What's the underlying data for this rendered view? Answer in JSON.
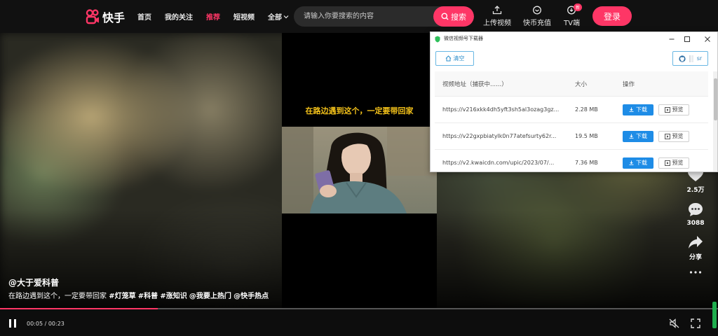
{
  "nav": {
    "logo_text": "快手",
    "items": [
      {
        "label": "首页",
        "active": false
      },
      {
        "label": "我的关注",
        "active": false
      },
      {
        "label": "推荐",
        "active": true
      },
      {
        "label": "短视频",
        "active": false
      }
    ],
    "all_label": "全部",
    "search": {
      "placeholder": "请输入你要搜索的内容",
      "button_label": "搜索"
    },
    "tools": [
      {
        "label": "上传视频",
        "icon": "upload-icon"
      },
      {
        "label": "快币充值",
        "icon": "coin-icon"
      },
      {
        "label": "TV端",
        "icon": "tv-icon",
        "badge": "新"
      }
    ],
    "login_label": "登录"
  },
  "video": {
    "caption": "在路边遇到这个，一定要带回家",
    "author": "@大于爱科普",
    "description": "在路边遇到这个，一定要带回家",
    "tags": [
      "#灯笼草",
      "#科普",
      "#涨知识",
      "@我要上热门",
      "@快手热点"
    ],
    "likes": "2.5万",
    "comments": "3088",
    "share_label": "分享",
    "current_time": "00:05",
    "duration": "00:23",
    "progress": 0.22
  },
  "downloader": {
    "title": "微信视频号下载器",
    "clear_label": "清空",
    "github_label": "sr",
    "columns": [
      "视频地址（捕获中......）",
      "大小",
      "操作"
    ],
    "download_label": "下载",
    "preview_label": "预览",
    "rows": [
      {
        "url": "https://v216xkk4dh5yft3sh5al3ozag3gz...",
        "size": "2.28 MB"
      },
      {
        "url": "https://v22gxpbiatylk0n77atefsurty62r...",
        "size": "19.5 MB"
      },
      {
        "url": "https://v2.kwaicdn.com/upic/2023/07/...",
        "size": "7.36 MB"
      }
    ]
  },
  "colors": {
    "accent": "#fe3666",
    "download_button": "#1e8ce6",
    "caption_yellow": "#f4c21a"
  }
}
